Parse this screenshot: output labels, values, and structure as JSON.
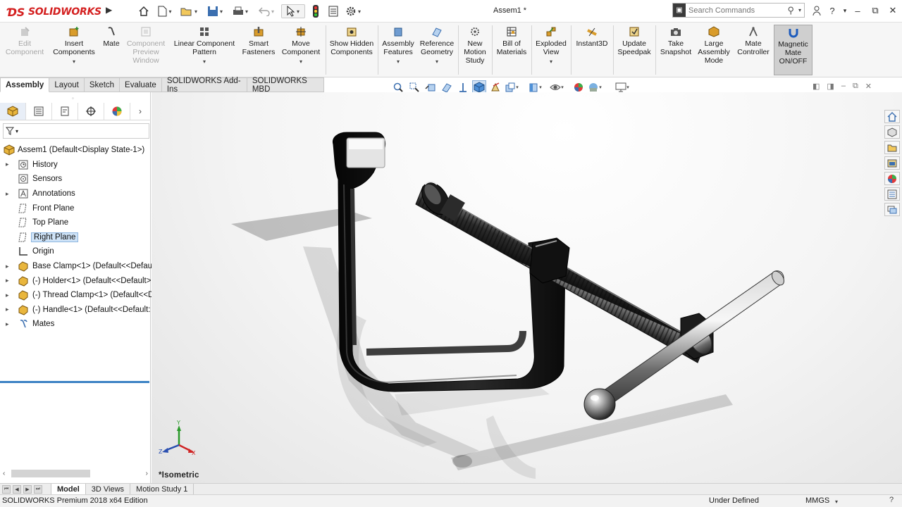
{
  "app": {
    "brand": "SOLIDWORKS",
    "title": "Assem1 *"
  },
  "search": {
    "placeholder": "Search Commands"
  },
  "command_manager": [
    {
      "label": "Edit Component",
      "icon": "edit-component-icon",
      "enabled": false
    },
    {
      "label": "Insert Components",
      "icon": "insert-components-icon",
      "enabled": true
    },
    {
      "label": "Mate",
      "icon": "mate-icon",
      "enabled": true
    },
    {
      "label": "Component Preview Window",
      "icon": "component-preview-icon",
      "enabled": false
    },
    {
      "label": "Linear Component Pattern",
      "icon": "linear-pattern-icon",
      "enabled": true
    },
    {
      "label": "Smart Fasteners",
      "icon": "smart-fasteners-icon",
      "enabled": true
    },
    {
      "label": "Move Component",
      "icon": "move-component-icon",
      "enabled": true
    },
    {
      "label": "Show Hidden Components",
      "icon": "show-hidden-icon",
      "enabled": true
    },
    {
      "label": "Assembly Features",
      "icon": "assembly-features-icon",
      "enabled": true
    },
    {
      "label": "Reference Geometry",
      "icon": "reference-geometry-icon",
      "enabled": true
    },
    {
      "label": "New Motion Study",
      "icon": "motion-study-icon",
      "enabled": true
    },
    {
      "label": "Bill of Materials",
      "icon": "bill-of-materials-icon",
      "enabled": true
    },
    {
      "label": "Exploded View",
      "icon": "exploded-view-icon",
      "enabled": true
    },
    {
      "label": "Instant3D",
      "icon": "instant3d-icon",
      "enabled": true
    },
    {
      "label": "Update Speedpak",
      "icon": "speedpak-icon",
      "enabled": true
    },
    {
      "label": "Take Snapshot",
      "icon": "snapshot-icon",
      "enabled": true
    },
    {
      "label": "Large Assembly Mode",
      "icon": "large-assembly-icon",
      "enabled": true
    },
    {
      "label": "Mate Controller",
      "icon": "mate-controller-icon",
      "enabled": true
    },
    {
      "label": "Magnetic Mate ON/OFF",
      "icon": "magnetic-mate-icon",
      "enabled": true
    }
  ],
  "tabs": [
    {
      "label": "Assembly",
      "active": true
    },
    {
      "label": "Layout"
    },
    {
      "label": "Sketch"
    },
    {
      "label": "Evaluate"
    },
    {
      "label": "SOLIDWORKS Add-Ins"
    },
    {
      "label": "SOLIDWORKS MBD"
    }
  ],
  "tree": {
    "root": "Assem1  (Default<Display State-1>)",
    "items": [
      {
        "label": "History",
        "icon": "history-icon",
        "expandable": true
      },
      {
        "label": "Sensors",
        "icon": "sensors-icon",
        "expandable": false
      },
      {
        "label": "Annotations",
        "icon": "annotations-icon",
        "expandable": true
      },
      {
        "label": "Front Plane",
        "icon": "plane-icon",
        "expandable": false
      },
      {
        "label": "Top Plane",
        "icon": "plane-icon",
        "expandable": false
      },
      {
        "label": "Right Plane",
        "icon": "plane-icon",
        "expandable": false,
        "selected": true
      },
      {
        "label": "Origin",
        "icon": "origin-icon",
        "expandable": false
      },
      {
        "label": "Base Clamp<1> (Default<<Defau",
        "icon": "part-icon",
        "expandable": true
      },
      {
        "label": "(-) Holder<1> (Default<<Default>",
        "icon": "part-icon",
        "expandable": true
      },
      {
        "label": "(-) Thread Clamp<1> (Default<<D",
        "icon": "part-icon",
        "expandable": true
      },
      {
        "label": "(-) Handle<1> (Default<<Default:",
        "icon": "part-icon",
        "expandable": true
      },
      {
        "label": "Mates",
        "icon": "mates-icon",
        "expandable": true
      }
    ]
  },
  "viewport": {
    "orientation": "*Isometric"
  },
  "bottom_tabs": [
    {
      "label": "Model",
      "active": true
    },
    {
      "label": "3D Views"
    },
    {
      "label": "Motion Study 1"
    }
  ],
  "status": {
    "app": "SOLIDWORKS Premium 2018 x64 Edition",
    "definition": "Under Defined",
    "units": "MMGS",
    "help": "?"
  },
  "colors": {
    "brand_red": "#d42020",
    "selection_blue": "#cfe3f7",
    "accent_blue": "#3b82c4"
  }
}
